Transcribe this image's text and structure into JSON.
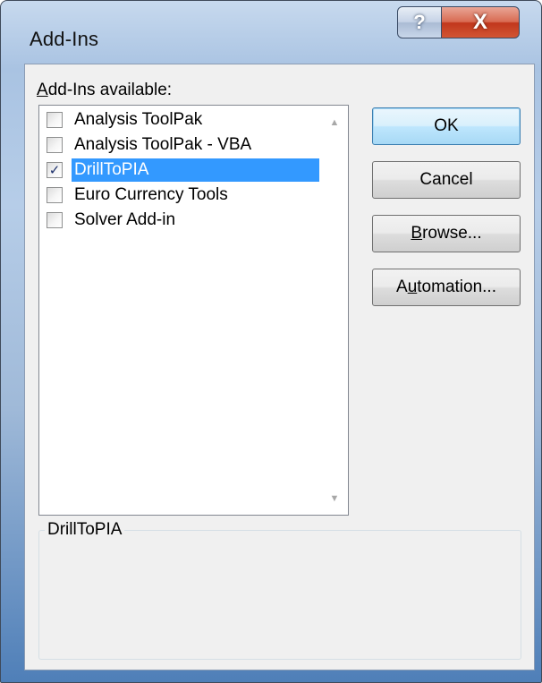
{
  "window": {
    "title": "Add-Ins",
    "help_glyph": "?",
    "close_glyph": "X"
  },
  "list": {
    "label_prefix": "A",
    "label_rest": "dd-Ins available:",
    "items": [
      {
        "label": "Analysis ToolPak",
        "checked": false,
        "selected": false,
        "check_glyph": ""
      },
      {
        "label": "Analysis ToolPak - VBA",
        "checked": false,
        "selected": false,
        "check_glyph": ""
      },
      {
        "label": "DrillToPIA",
        "checked": true,
        "selected": true,
        "check_glyph": "✓"
      },
      {
        "label": "Euro Currency Tools",
        "checked": false,
        "selected": false,
        "check_glyph": ""
      },
      {
        "label": "Solver Add-in",
        "checked": false,
        "selected": false,
        "check_glyph": ""
      }
    ],
    "scroll_up_glyph": "▲",
    "scroll_down_glyph": "▼"
  },
  "buttons": {
    "ok": "OK",
    "cancel": "Cancel",
    "browse_ul": "B",
    "browse_rest": "rowse...",
    "automation_pre": "A",
    "automation_ul": "u",
    "automation_rest": "tomation..."
  },
  "description": {
    "title": "DrillToPIA",
    "body": ""
  },
  "colors": {
    "selection": "#3399ff",
    "close_button": "#c1371c",
    "window_frame": "#a9c3e2"
  }
}
